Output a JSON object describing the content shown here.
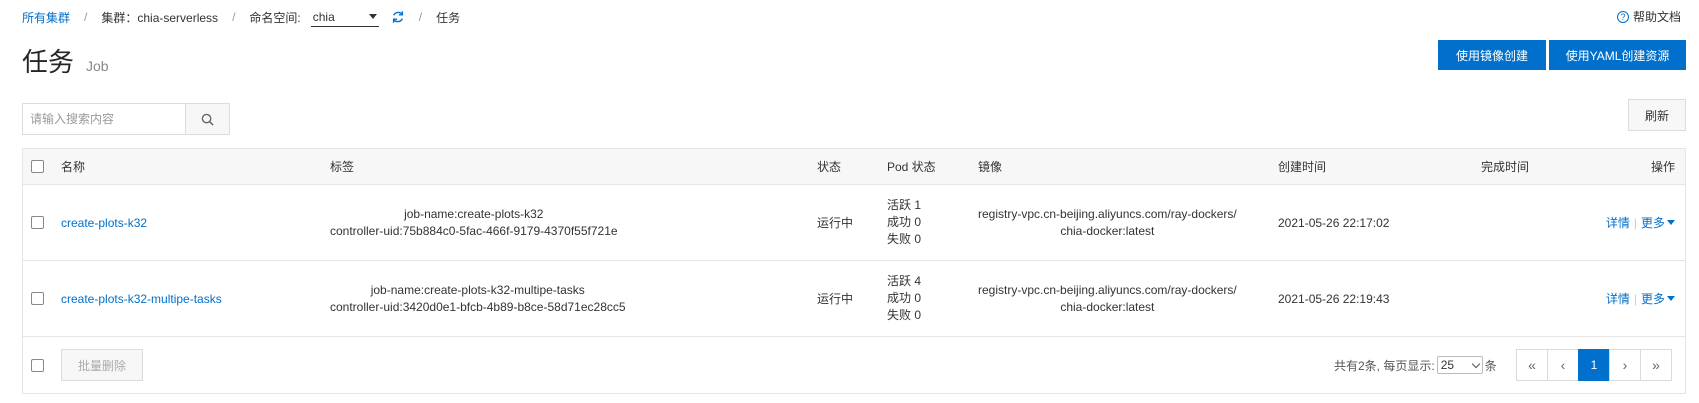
{
  "breadcrumb": {
    "all_clusters": "所有集群",
    "sep": "/",
    "cluster": "集群：chia-serverless",
    "namespace_label": "命名空间:",
    "namespace_value": "chia",
    "current": "任务"
  },
  "help": {
    "label": "帮助文档"
  },
  "page": {
    "title": "任务",
    "subtitle": "Job"
  },
  "actions": {
    "create_by_image": "使用镜像创建",
    "create_by_yaml": "使用YAML创建资源",
    "refresh": "刷新"
  },
  "search": {
    "placeholder": "请输入搜索内容",
    "value": ""
  },
  "table": {
    "columns": [
      "名称",
      "标签",
      "状态",
      "Pod 状态",
      "镜像",
      "创建时间",
      "完成时间",
      "操作"
    ],
    "rows": [
      {
        "name": "create-plots-k32",
        "labels": [
          "job-name:create-plots-k32",
          "controller-uid:75b884c0-5fac-466f-9179-4370f55f721e"
        ],
        "status": "运行中",
        "pod_status": [
          "活跃 1",
          "成功 0",
          "失败 0"
        ],
        "image": [
          "registry-vpc.cn-beijing.aliyuncs.com/ray-dockers/",
          "chia-docker:latest"
        ],
        "created": "2021-05-26 22:17:02",
        "finished": "",
        "op_detail": "详情",
        "op_more": "更多"
      },
      {
        "name": "create-plots-k32-multipe-tasks",
        "labels": [
          "job-name:create-plots-k32-multipe-tasks",
          "controller-uid:3420d0e1-bfcb-4b89-b8ce-58d71ec28cc5"
        ],
        "status": "运行中",
        "pod_status": [
          "活跃 4",
          "成功 0",
          "失败 0"
        ],
        "image": [
          "registry-vpc.cn-beijing.aliyuncs.com/ray-dockers/",
          "chia-docker:latest"
        ],
        "created": "2021-05-26 22:19:43",
        "finished": "",
        "op_detail": "详情",
        "op_more": "更多"
      }
    ]
  },
  "footer": {
    "batch_delete": "批量删除",
    "total_text": "共有2条, 每页显示:",
    "page_size": "25",
    "unit": "条",
    "pager": {
      "first": "«",
      "prev": "‹",
      "current": "1",
      "next": "›",
      "last": "»"
    }
  },
  "colors": {
    "primary": "#0070cc",
    "border": "#e5e5e5",
    "header_bg": "#f7f7f7"
  }
}
